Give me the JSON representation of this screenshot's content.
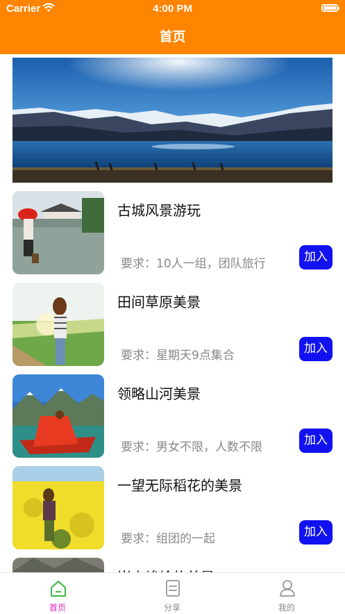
{
  "status_bar": {
    "carrier": "Carrier",
    "time": "4:00 PM"
  },
  "nav": {
    "title": "首页",
    "bar_color": "#FF8400"
  },
  "activities": [
    {
      "title": "古城风景游玩",
      "requirement": "要求：10人一组，团队旅行",
      "button": "加入"
    },
    {
      "title": "田间草原美景",
      "requirement": "要求：星期天9点集合",
      "button": "加入"
    },
    {
      "title": "领略山河美景",
      "requirement": "要求：男女不限，人数不限",
      "button": "加入"
    },
    {
      "title": "一望无际稻花的美景",
      "requirement": "要求：组团的一起",
      "button": "加入"
    },
    {
      "title": "崇山峻岭的美景"
    }
  ],
  "tabs": [
    {
      "label": "首页",
      "icon": "home-icon",
      "selected": true
    },
    {
      "label": "分享",
      "icon": "document-icon",
      "selected": false
    },
    {
      "label": "我的",
      "icon": "person-icon",
      "selected": false
    }
  ],
  "colors": {
    "accent": "#FF8400",
    "button": "#1212F0",
    "tab_selected_label": "#E020C0",
    "tab_selected_icon": "#4CB94C",
    "tab_inactive": "#A0A0A0"
  }
}
